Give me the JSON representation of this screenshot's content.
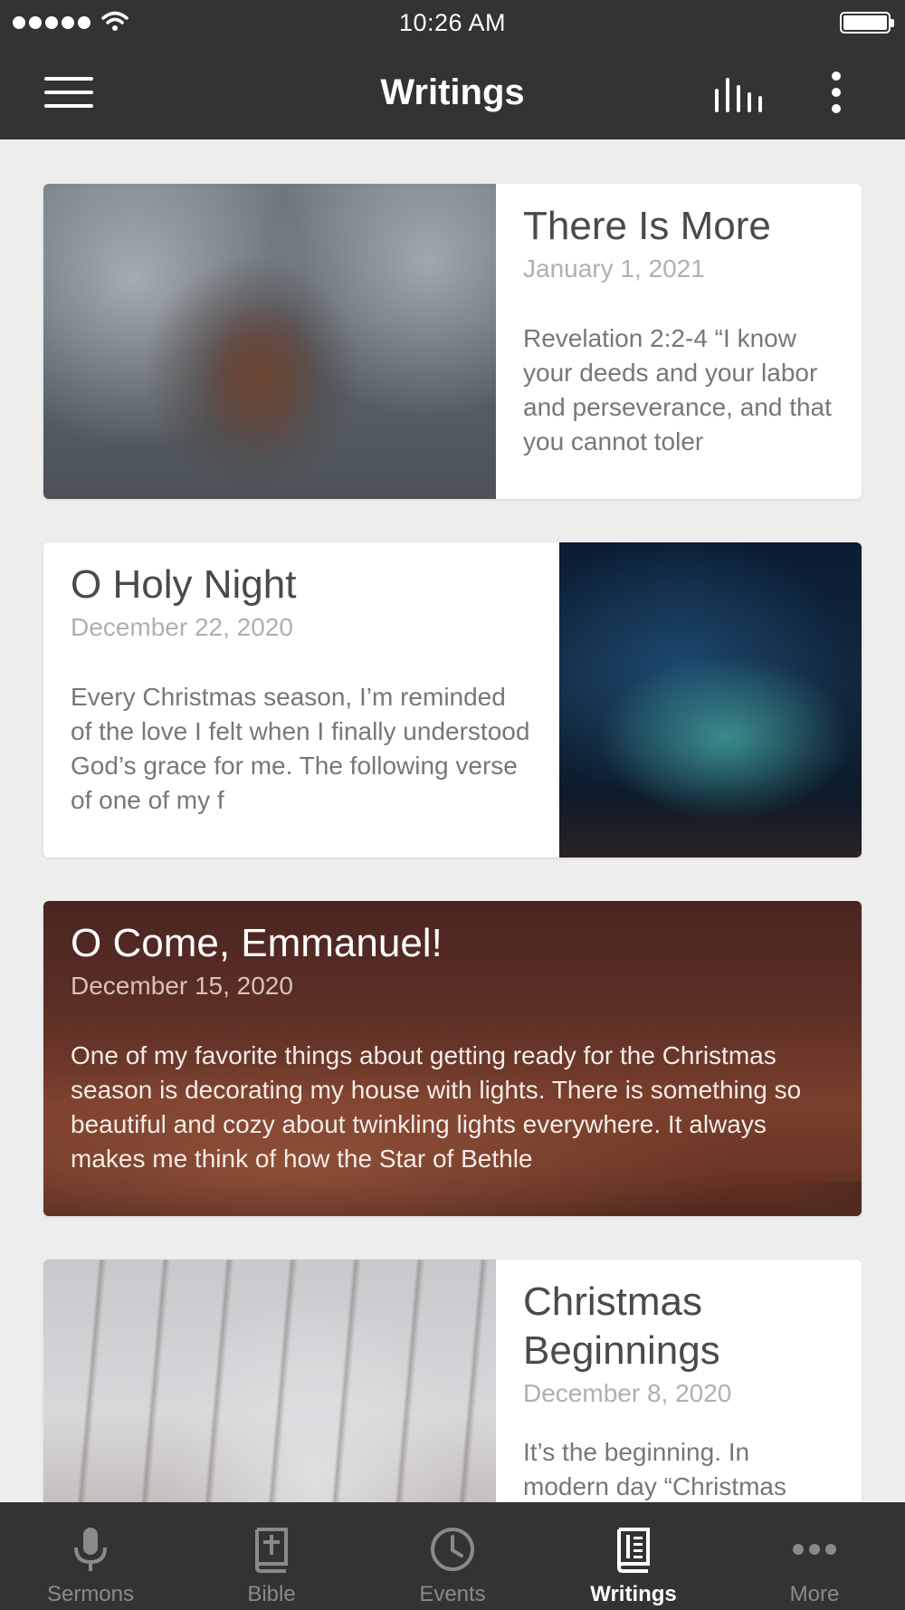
{
  "status_bar": {
    "time": "10:26 AM"
  },
  "nav": {
    "title": "Writings"
  },
  "cards": [
    {
      "title": "There Is More",
      "date": "January 1, 2021",
      "excerpt": "Revelation 2:2-4  “I know your deeds and your labor and perseverance, and that you cannot toler"
    },
    {
      "title": "O Holy Night",
      "date": "December 22, 2020",
      "excerpt": "Every Christmas season, I’m reminded of the love I felt when I finally understood God’s grace for me. The following verse of one of my f"
    },
    {
      "title": "O Come, Emmanuel!",
      "date": "December 15, 2020",
      "excerpt": "One of my favorite things about getting ready for the Christmas season is decorating my house with lights. There is something so beautiful and cozy about twinkling lights everywhere. It always makes me think of how the Star of Bethle"
    },
    {
      "title": "Christmas Beginnings",
      "date": "December 8, 2020",
      "excerpt": "It’s the beginning. In modern day “Christmas"
    }
  ],
  "tabs": [
    {
      "label": "Sermons",
      "icon": "microphone-icon"
    },
    {
      "label": "Bible",
      "icon": "bible-icon"
    },
    {
      "label": "Events",
      "icon": "clock-icon"
    },
    {
      "label": "Writings",
      "icon": "writings-icon",
      "active": true
    },
    {
      "label": "More",
      "icon": "more-dots-icon"
    }
  ]
}
